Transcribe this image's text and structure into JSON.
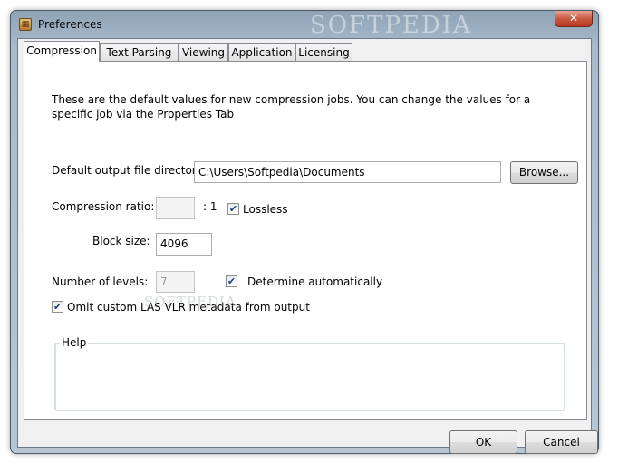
{
  "window": {
    "title": "Preferences",
    "watermark": "SOFTPEDIA",
    "close_glyph": "✕",
    "icon": "app-icon"
  },
  "tabs": [
    {
      "label": "Compression",
      "active": true
    },
    {
      "label": "Text Parsing",
      "active": false
    },
    {
      "label": "Viewing",
      "active": false
    },
    {
      "label": "Application",
      "active": false
    },
    {
      "label": "Licensing",
      "active": false
    }
  ],
  "compression": {
    "description": "These are the default values for new compression jobs. You can change the values for a specific job via the Properties Tab",
    "output_dir_label": "Default output file directory:",
    "output_dir_value": "C:\\Users\\Softpedia\\Documents",
    "browse_label": "Browse...",
    "ratio_label": "Compression ratio:",
    "ratio_value": "",
    "ratio_suffix": ": 1",
    "lossless_label": "Lossless",
    "lossless_checked": true,
    "block_size_label": "Block size:",
    "block_size_value": "4096",
    "levels_label": "Number of levels:",
    "levels_value": "7",
    "auto_label": "Determine automatically",
    "auto_checked": true,
    "omit_label": "Omit custom LAS VLR metadata from output",
    "omit_checked": true,
    "help_title": "Help",
    "help_text": "",
    "watermark": "SOFTPEDIA"
  },
  "footer": {
    "ok_label": "OK",
    "cancel_label": "Cancel"
  },
  "check_glyph": "✔"
}
